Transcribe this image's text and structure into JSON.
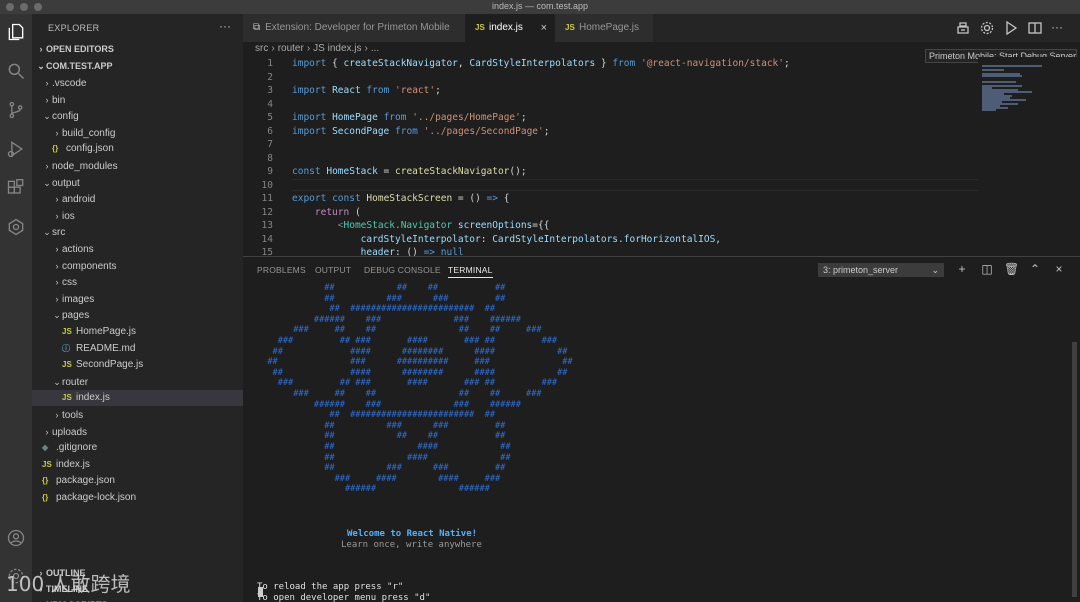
{
  "window": {
    "title": "index.js — com.test.app"
  },
  "sidebar": {
    "header": "EXPLORER",
    "more": "···",
    "sections": [
      {
        "label": "OPEN EDITORS",
        "expanded": false
      },
      {
        "label": "COM.TEST.APP",
        "expanded": true
      }
    ],
    "tree": [
      {
        "label": ".vscode",
        "type": "folder",
        "expanded": false,
        "depth": 1
      },
      {
        "label": "bin",
        "type": "folder",
        "expanded": false,
        "depth": 1
      },
      {
        "label": "config",
        "type": "folder",
        "expanded": true,
        "depth": 1
      },
      {
        "label": "build_config",
        "type": "folder",
        "expanded": false,
        "depth": 2
      },
      {
        "label": "config.json",
        "type": "json",
        "depth": 2
      },
      {
        "label": "node_modules",
        "type": "folder",
        "expanded": false,
        "depth": 1
      },
      {
        "label": "output",
        "type": "folder",
        "expanded": true,
        "depth": 1
      },
      {
        "label": "android",
        "type": "folder",
        "expanded": false,
        "depth": 2
      },
      {
        "label": "ios",
        "type": "folder",
        "expanded": false,
        "depth": 2
      },
      {
        "label": "src",
        "type": "folder",
        "expanded": true,
        "depth": 1
      },
      {
        "label": "actions",
        "type": "folder",
        "expanded": false,
        "depth": 2
      },
      {
        "label": "components",
        "type": "folder",
        "expanded": false,
        "depth": 2
      },
      {
        "label": "css",
        "type": "folder",
        "expanded": false,
        "depth": 2
      },
      {
        "label": "images",
        "type": "folder",
        "expanded": false,
        "depth": 2
      },
      {
        "label": "pages",
        "type": "folder",
        "expanded": true,
        "depth": 2
      },
      {
        "label": "HomePage.js",
        "type": "js",
        "depth": 3
      },
      {
        "label": "README.md",
        "type": "md",
        "depth": 3
      },
      {
        "label": "SecondPage.js",
        "type": "js",
        "depth": 3
      },
      {
        "label": "router",
        "type": "folder",
        "expanded": true,
        "depth": 2
      },
      {
        "label": "index.js",
        "type": "js",
        "depth": 3,
        "selected": true
      },
      {
        "label": "tools",
        "type": "folder",
        "expanded": false,
        "depth": 2
      },
      {
        "label": "uploads",
        "type": "folder",
        "expanded": false,
        "depth": 1
      },
      {
        "label": ".gitignore",
        "type": "git",
        "depth": 1
      },
      {
        "label": "index.js",
        "type": "js",
        "depth": 1
      },
      {
        "label": "package.json",
        "type": "json",
        "depth": 1
      },
      {
        "label": "package-lock.json",
        "type": "json",
        "depth": 1
      }
    ],
    "bottom_sections": [
      "OUTLINE",
      "TIMELINE",
      "NPM SCRIPTS"
    ]
  },
  "tabs": [
    {
      "label": "Extension: Developer for Primeton Mobile",
      "icon": "extension-icon",
      "active": false
    },
    {
      "label": "index.js",
      "icon": "JS",
      "active": true,
      "close": "×"
    },
    {
      "label": "HomePage.js",
      "icon": "JS",
      "active": false
    }
  ],
  "tooltip": "Primeton Mobile: Start Debug Server",
  "breadcrumb": [
    "src",
    "router",
    "JS index.js",
    "..."
  ],
  "editor": {
    "lines": [
      {
        "n": "1",
        "tokens": [
          [
            "kw",
            "import"
          ],
          [
            "plain",
            " { "
          ],
          [
            "var",
            "createStackNavigator"
          ],
          [
            "plain",
            ", "
          ],
          [
            "var",
            "CardStyleInterpolators"
          ],
          [
            "plain",
            " } "
          ],
          [
            "kw",
            "from"
          ],
          [
            "plain",
            " "
          ],
          [
            "str",
            "'@react-navigation/stack'"
          ],
          [
            "plain",
            ";"
          ]
        ]
      },
      {
        "n": "2",
        "tokens": []
      },
      {
        "n": "3",
        "tokens": [
          [
            "kw",
            "import"
          ],
          [
            "plain",
            " "
          ],
          [
            "var",
            "React"
          ],
          [
            "plain",
            " "
          ],
          [
            "kw",
            "from"
          ],
          [
            "plain",
            " "
          ],
          [
            "str",
            "'react'"
          ],
          [
            "plain",
            ";"
          ]
        ]
      },
      {
        "n": "4",
        "tokens": []
      },
      {
        "n": "5",
        "tokens": [
          [
            "kw",
            "import"
          ],
          [
            "plain",
            " "
          ],
          [
            "var",
            "HomePage"
          ],
          [
            "plain",
            " "
          ],
          [
            "kw",
            "from"
          ],
          [
            "plain",
            " "
          ],
          [
            "str",
            "'../pages/HomePage'"
          ],
          [
            "plain",
            ";"
          ]
        ]
      },
      {
        "n": "6",
        "tokens": [
          [
            "kw",
            "import"
          ],
          [
            "plain",
            " "
          ],
          [
            "var",
            "SecondPage"
          ],
          [
            "plain",
            " "
          ],
          [
            "kw",
            "from"
          ],
          [
            "plain",
            " "
          ],
          [
            "str",
            "'../pages/SecondPage'"
          ],
          [
            "plain",
            ";"
          ]
        ]
      },
      {
        "n": "7",
        "tokens": []
      },
      {
        "n": "8",
        "tokens": []
      },
      {
        "n": "9",
        "tokens": [
          [
            "kw",
            "const"
          ],
          [
            "plain",
            " "
          ],
          [
            "var",
            "HomeStack"
          ],
          [
            "plain",
            " = "
          ],
          [
            "fn",
            "createStackNavigator"
          ],
          [
            "plain",
            "();"
          ]
        ]
      },
      {
        "n": "10",
        "tokens": []
      },
      {
        "n": "11",
        "tokens": [
          [
            "kw",
            "export"
          ],
          [
            "plain",
            " "
          ],
          [
            "kw",
            "const"
          ],
          [
            "plain",
            " "
          ],
          [
            "fn",
            "HomeStackScreen"
          ],
          [
            "plain",
            " = () "
          ],
          [
            "kw",
            "=>"
          ],
          [
            "plain",
            " {"
          ]
        ]
      },
      {
        "n": "12",
        "tokens": [
          [
            "plain",
            "    "
          ],
          [
            "ctrl",
            "return"
          ],
          [
            "plain",
            " ("
          ]
        ]
      },
      {
        "n": "13",
        "tokens": [
          [
            "plain",
            "        "
          ],
          [
            "punct",
            "<"
          ],
          [
            "tag",
            "HomeStack.Navigator"
          ],
          [
            "plain",
            " "
          ],
          [
            "var",
            "screenOptions"
          ],
          [
            "plain",
            "={{"
          ]
        ]
      },
      {
        "n": "14",
        "tokens": [
          [
            "plain",
            "            "
          ],
          [
            "var",
            "cardStyleInterpolator"
          ],
          [
            "plain",
            ": "
          ],
          [
            "var",
            "CardStyleInterpolators"
          ],
          [
            "plain",
            "."
          ],
          [
            "var",
            "forHorizontalIOS"
          ],
          [
            "plain",
            ","
          ]
        ]
      },
      {
        "n": "15",
        "tokens": [
          [
            "plain",
            "            "
          ],
          [
            "var",
            "header"
          ],
          [
            "plain",
            ": () "
          ],
          [
            "kw",
            "=>"
          ],
          [
            "plain",
            " "
          ],
          [
            "kw",
            "null"
          ]
        ]
      }
    ]
  },
  "panel": {
    "tabs": [
      "PROBLEMS",
      "OUTPUT",
      "DEBUG CONSOLE",
      "TERMINAL"
    ],
    "active_tab": "TERMINAL",
    "terminal_select": "3: primeton_server",
    "icons": [
      "add-icon",
      "split-icon",
      "trash-icon",
      "chevron-up-icon",
      "close-icon"
    ],
    "ascii_art": [
      "             ##            ##    ##           ##",
      "             ##          ###      ###         ##",
      "              ##  ########################  ##",
      "           ######    ###              ###    ######",
      "       ###     ##    ##                ##    ##     ###",
      "    ###         ## ###       ####       ### ##         ###",
      "   ##             ####      ########      ####            ##",
      "  ##              ###      ##########     ###              ##",
      "   ##             ####      ########      ####            ##",
      "    ###         ## ###       ####       ### ##         ###",
      "       ###     ##    ##                ##    ##     ###",
      "           ######    ###              ###    ######",
      "              ##  ########################  ##",
      "             ##          ###      ###         ##",
      "             ##            ##    ##           ##",
      "             ##                ####            ##",
      "             ##              ####              ##",
      "             ##          ###      ###         ##",
      "               ###     ####        ####     ###",
      "                 ######                ######"
    ],
    "welcome": "Welcome to React Native!",
    "tagline": "Learn once, write anywhere",
    "reload_hint": "To reload the app press \"r\"",
    "devmenu_hint": "To open developer menu press \"d\""
  },
  "watermark": "100 人敢跨境"
}
